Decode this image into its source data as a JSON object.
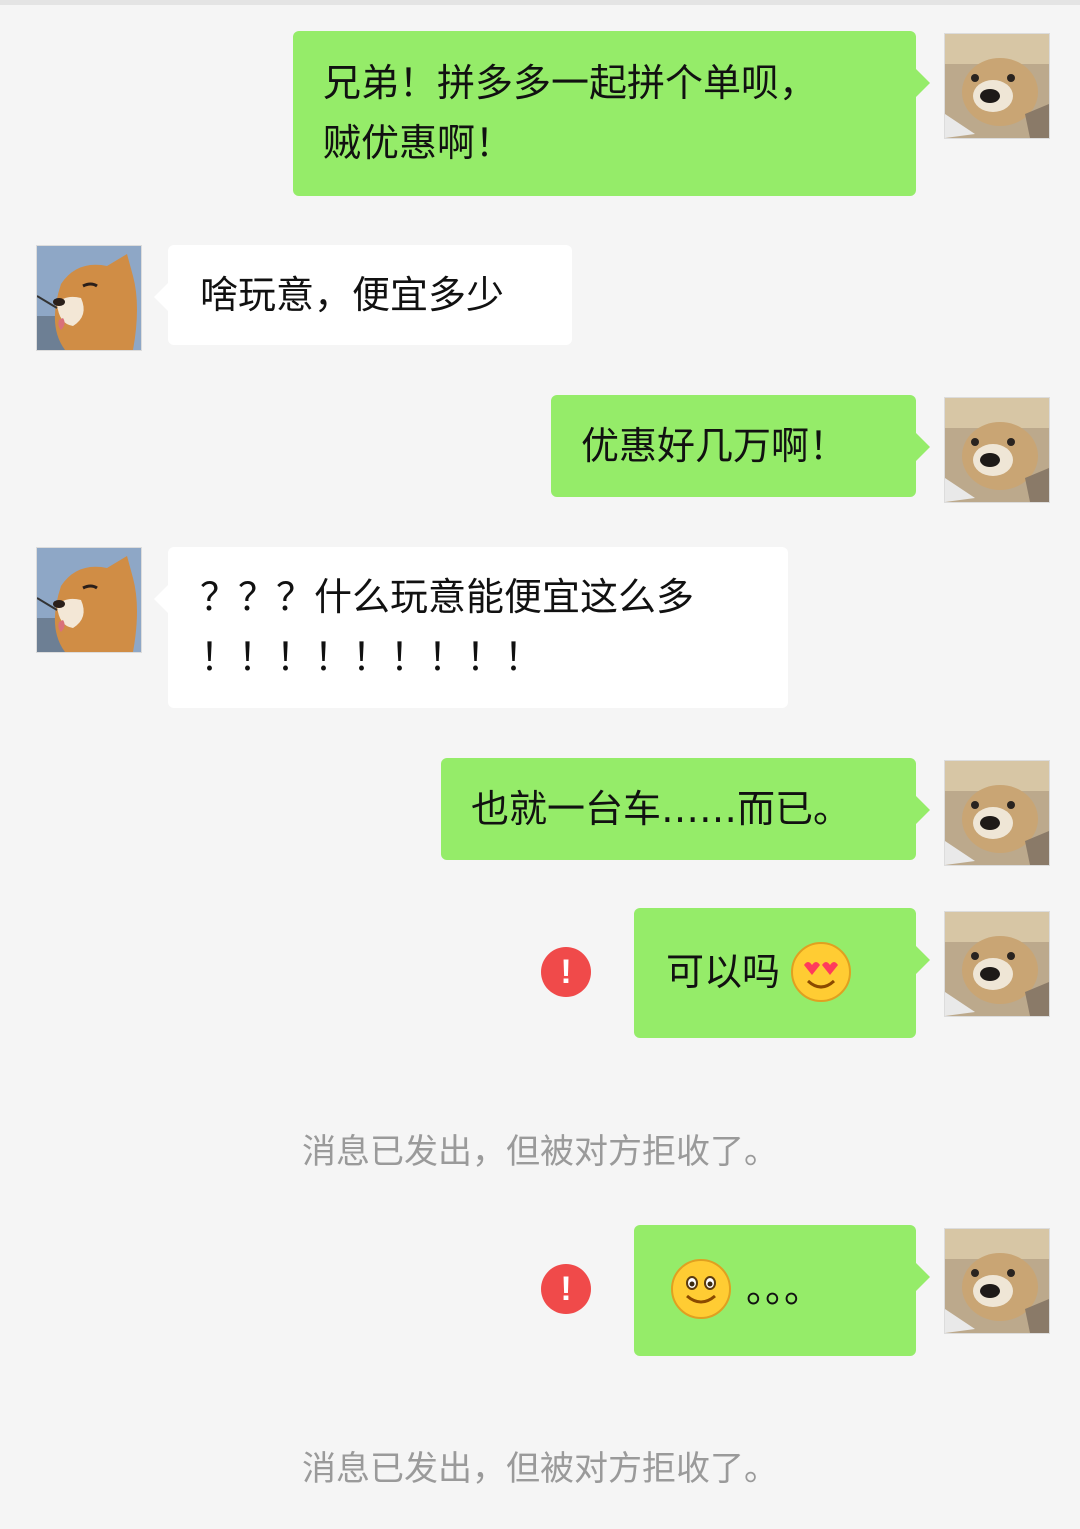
{
  "messages": [
    {
      "side": "right",
      "lines": [
        "兄弟！拼多多一起拼个单呗，",
        "贼优惠啊！"
      ]
    },
    {
      "side": "left",
      "lines": [
        "啥玩意，便宜多少"
      ]
    },
    {
      "side": "right",
      "lines": [
        "优惠好几万啊！"
      ]
    },
    {
      "side": "left",
      "lines": [
        "？？？什么玩意能便宜这么多",
        "！！！！！！！！！"
      ]
    },
    {
      "side": "right",
      "lines": [
        "也就一台车……而已。"
      ]
    },
    {
      "side": "right",
      "lines": [
        "可以吗"
      ],
      "emoji": "heart-eyes-emoji",
      "failed": true,
      "fail_icon": "!"
    },
    {
      "side": "right",
      "lines": [
        "。。。"
      ],
      "emoji": "smile-emoji",
      "failed": true,
      "fail_icon": "!"
    }
  ],
  "system_notices": [
    "消息已发出，但被对方拒收了。",
    "消息已发出，但被对方拒收了。"
  ],
  "avatars": {
    "self": "shiba-upside-down-avatar",
    "contact": "shiba-side-avatar"
  },
  "colors": {
    "background": "#f5f5f5",
    "sent_bubble": "#95ec69",
    "received_bubble": "#ffffff",
    "error": "#f04a4a",
    "notice_text": "#9a9a9a"
  }
}
